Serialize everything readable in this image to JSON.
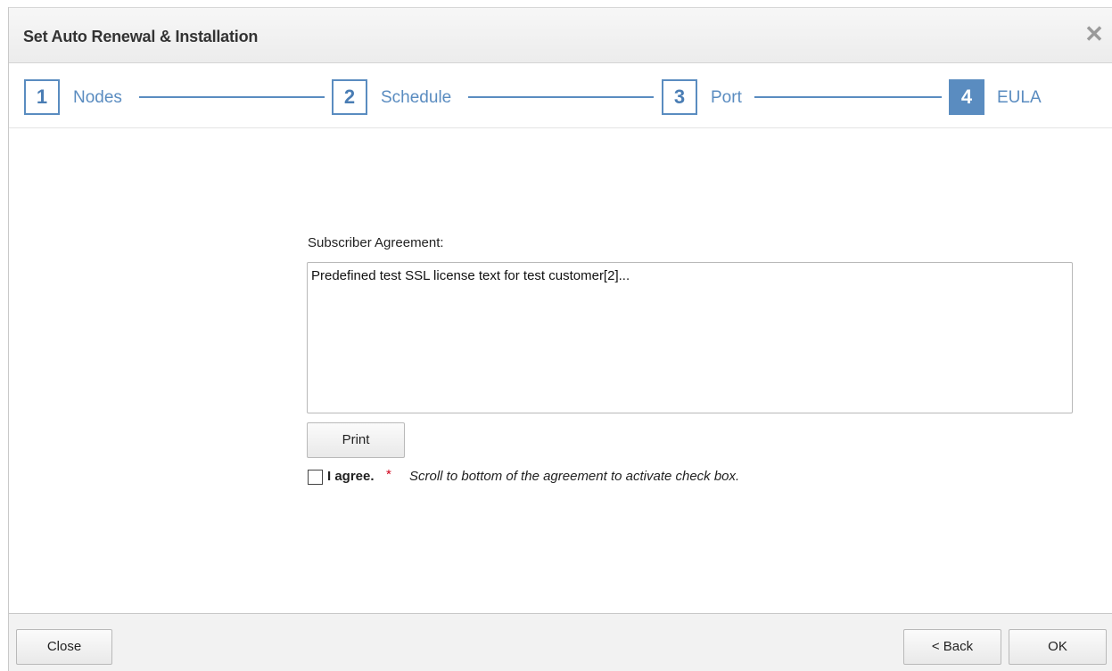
{
  "dialog": {
    "title": "Set Auto Renewal & Installation",
    "close_glyph": "✕"
  },
  "stepper": {
    "steps": [
      {
        "number": "1",
        "label": "Nodes",
        "active": false
      },
      {
        "number": "2",
        "label": "Schedule",
        "active": false
      },
      {
        "number": "3",
        "label": "Port",
        "active": false
      },
      {
        "number": "4",
        "label": "EULA",
        "active": true
      }
    ],
    "accent_color": "#5a8cc0"
  },
  "eula": {
    "heading": "Subscriber Agreement:",
    "agreement_text": "Predefined test SSL license text for test customer[2]...",
    "print_label": "Print",
    "agree_label": "I agree.",
    "required_marker": "*",
    "scroll_hint": "Scroll to bottom of the agreement to activate check box.",
    "agree_checked": false
  },
  "footer": {
    "close_label": "Close",
    "back_label": "< Back",
    "ok_label": "OK"
  }
}
